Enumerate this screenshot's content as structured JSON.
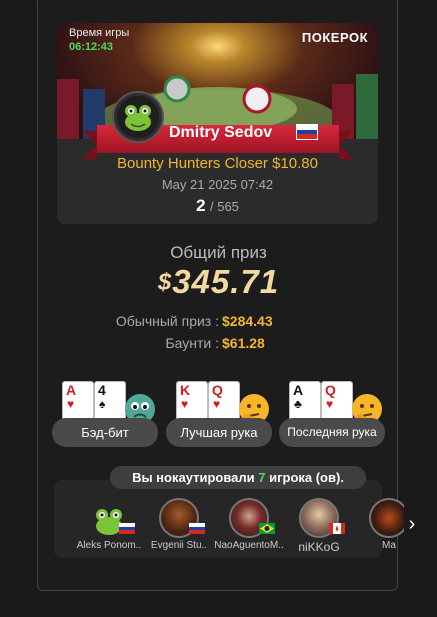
{
  "header": {
    "timer_label": "Время игры",
    "timer_value": "06:12:43",
    "brand": "ПОКЕРОК"
  },
  "player": {
    "name": "Dmitry Sedov",
    "flag": "ru-flag"
  },
  "tournament": {
    "name": "Bounty Hunters Closer $10.80",
    "date": "May 21 2025 07:42",
    "place": "2",
    "total_players": "/ 565"
  },
  "prize": {
    "title": "Общий приз",
    "currency": "$",
    "total": "345.71",
    "regular_label": "Обычный приз :",
    "regular_value": "$284.43",
    "bounty_label": "Баунти :",
    "bounty_value": "$61.28"
  },
  "awards": [
    {
      "label": "Бэд-бит",
      "cards": [
        {
          "rank": "A",
          "suit": "♥"
        },
        {
          "rank": "4",
          "suit": "♠"
        }
      ],
      "icon": "sad-monster-icon"
    },
    {
      "label": "Лучшая рука",
      "cards": [
        {
          "rank": "K",
          "suit": "♥"
        },
        {
          "rank": "Q",
          "suit": "♥"
        }
      ],
      "icon": "thinking-emoji-icon"
    },
    {
      "label": "Последняя рука",
      "cards": [
        {
          "rank": "A",
          "suit": "♣"
        },
        {
          "rank": "Q",
          "suit": "♥"
        }
      ],
      "icon": "thinking-emoji-icon"
    }
  ],
  "knockouts": {
    "prefix": "Вы нокаутировали ",
    "count": "7",
    "suffix": " игрока (ов).",
    "victims": [
      {
        "name": "Aleks Ponom..",
        "flag": "ru"
      },
      {
        "name": "Evgenii Stu..",
        "flag": "ru"
      },
      {
        "name": "NaoAguentoM..",
        "flag": "br"
      },
      {
        "name": "niKKoG",
        "flag": "ca"
      },
      {
        "name": "Ma",
        "flag": ""
      }
    ]
  },
  "colors": {
    "accent_gold": "#f2b632",
    "accent_green": "#4cd964",
    "ribbon_red": "#c8202f"
  }
}
